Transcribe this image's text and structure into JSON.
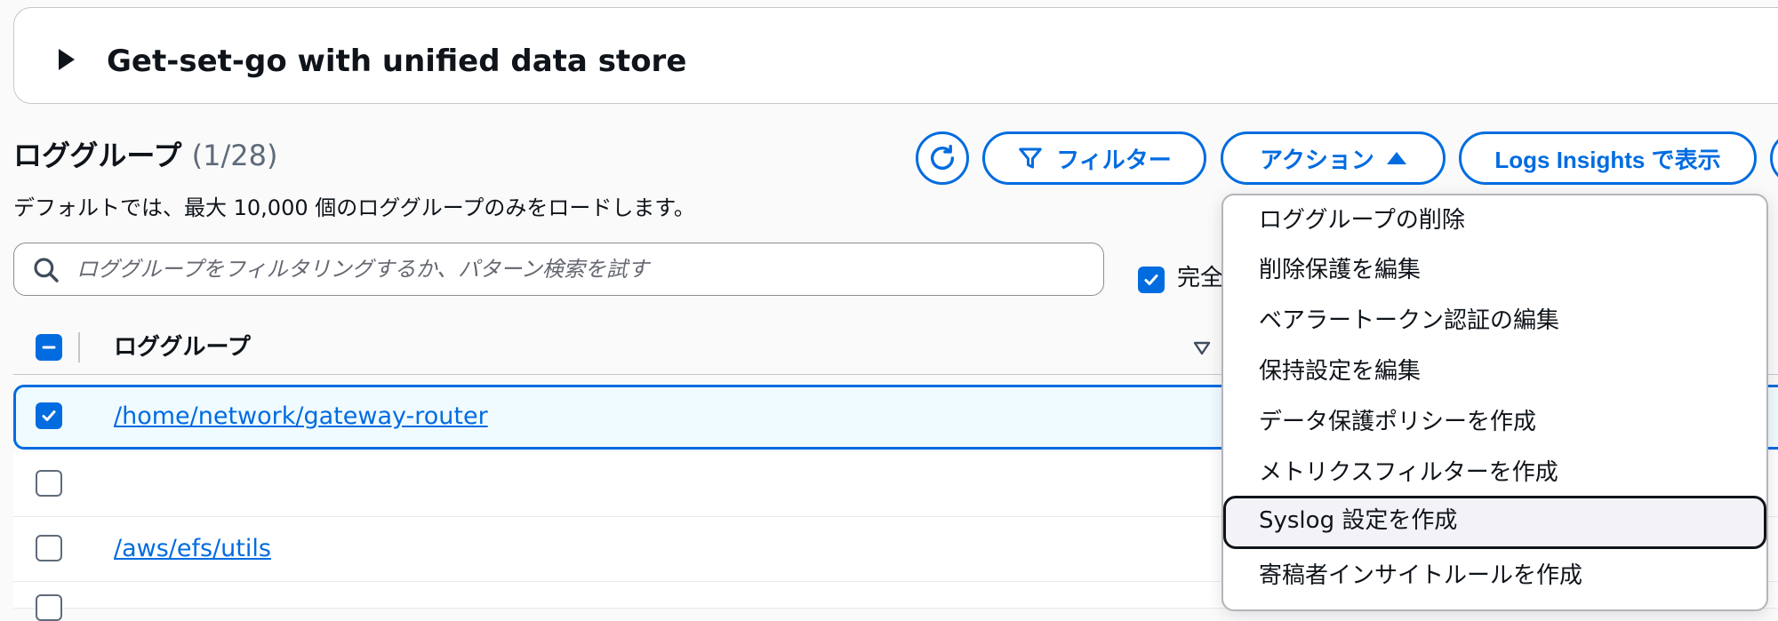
{
  "banner": {
    "title": "Get-set-go with unified data store"
  },
  "section": {
    "title": "ロググループ",
    "count": "(1/28)",
    "subtitle": "デフォルトでは、最大 10,000 個のロググループのみをロードします。"
  },
  "toolbar": {
    "filter_label": "フィルター",
    "actions_label": "アクション",
    "insights_label": "Logs Insights で表示"
  },
  "search": {
    "placeholder": "ロググループをフィルタリングするか、パターン検索を試す",
    "value": "",
    "exact_match_label": "完全"
  },
  "table": {
    "header": "ロググループ",
    "rows": [
      {
        "name": "/home/network/gateway-router",
        "selected": true
      },
      {
        "name": "",
        "selected": false
      },
      {
        "name": "/aws/efs/utils",
        "selected": false
      }
    ]
  },
  "actions_menu": {
    "items": [
      {
        "label": "ロググループの削除"
      },
      {
        "label": "削除保護を編集"
      },
      {
        "label": "ベアラートークン認証の編集"
      },
      {
        "label": "保持設定を編集"
      },
      {
        "label": "データ保護ポリシーを作成"
      },
      {
        "label": "メトリクスフィルターを作成"
      },
      {
        "label": "Syslog 設定を作成"
      },
      {
        "label": "寄稿者インサイトルールを作成"
      }
    ],
    "highlighted_index": 6
  },
  "colors": {
    "accent": "#006ce0",
    "text": "#0f141a",
    "selected_row_bg": "#f0fbff"
  }
}
